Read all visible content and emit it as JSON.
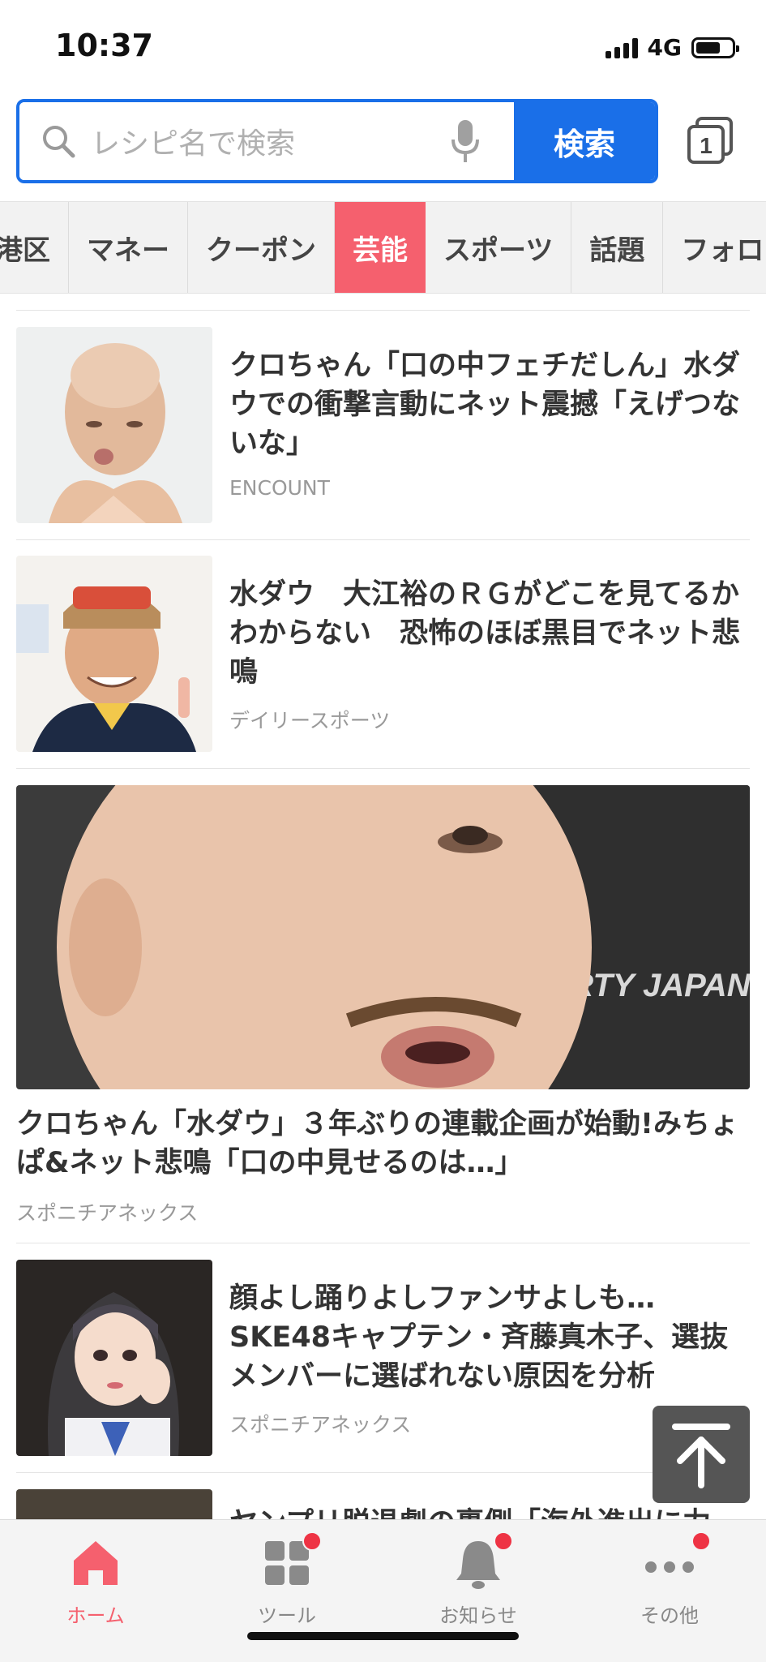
{
  "status": {
    "time": "10:37",
    "network": "4G",
    "battery_level": 0.7
  },
  "search": {
    "placeholder": "レシピ名で検索",
    "button": "検索",
    "tab_count": "1"
  },
  "categories": [
    {
      "label": "港区"
    },
    {
      "label": "マネー"
    },
    {
      "label": "クーポン"
    },
    {
      "label": "芸能",
      "active": true
    },
    {
      "label": "スポーツ"
    },
    {
      "label": "話題"
    },
    {
      "label": "フォロー"
    }
  ],
  "articles": [
    {
      "title": "クロちゃん「口の中フェチだしん」水ダウでの衝撃言動にネット震撼「えげつないな」",
      "source": "ENCOUNT"
    },
    {
      "title": "水ダウ　大江裕のＲＧがどこを見てるかわからない　恐怖のほぼ黒目でネット悲鳴",
      "source": "デイリースポーツ"
    },
    {
      "title": "クロちゃん「水ダウ」３年ぶりの連載企画が始動!みちょぱ&ネット悲鳴「口の中見せるのは…」",
      "source": "スポニチアネックス"
    },
    {
      "title": "顔よし踊りよしファンサよしも…SKE48キャプテン・斉藤真木子、選抜メンバーに選ばれない原因を分析",
      "source": "スポニチアネックス"
    },
    {
      "title": "ヤンプリ脱退劇の裏側「海外進出に力…",
      "source": ""
    }
  ],
  "big_image_text": "ARTY JAPAN",
  "bottom_nav": [
    {
      "label": "ホーム",
      "active": true
    },
    {
      "label": "ツール",
      "badge": true
    },
    {
      "label": "お知らせ",
      "badge": true
    },
    {
      "label": "その他",
      "badge": true
    }
  ],
  "colors": {
    "accent": "#1a6fe8",
    "active_tab": "#f5606e",
    "badge": "#ee3344"
  }
}
